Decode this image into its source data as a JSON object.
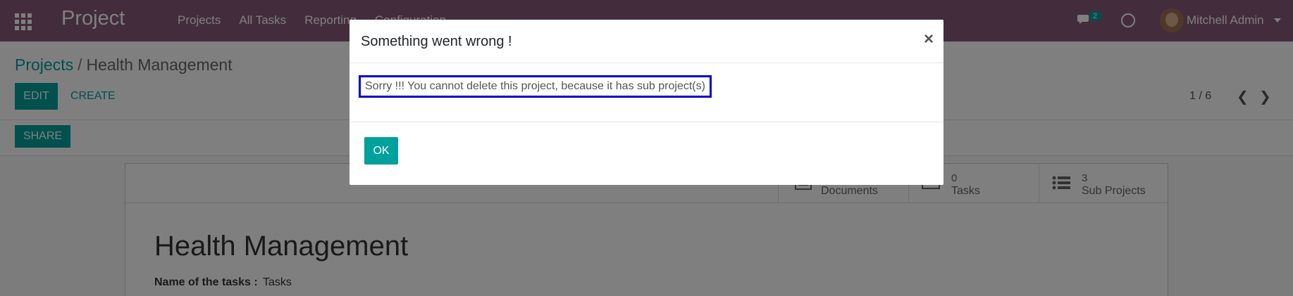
{
  "navbar": {
    "brand": "Project",
    "menu": [
      "Projects",
      "All Tasks",
      "Reporting",
      "Configuration"
    ],
    "chat_count": "2",
    "user_name": "Mitchell Admin",
    "color": "#875a7b"
  },
  "breadcrumb": {
    "parent": "Projects",
    "separator": "/",
    "current": "Health Management"
  },
  "actions": {
    "edit": "EDIT",
    "create": "CREATE",
    "share": "SHARE",
    "pager": "1 / 6"
  },
  "stats": [
    {
      "value": "",
      "label": "Documents",
      "icon": "document-icon"
    },
    {
      "value": "0",
      "label": "Tasks",
      "icon": "tasks-icon"
    },
    {
      "value": "3",
      "label": "Sub Projects",
      "icon": "list-icon"
    }
  ],
  "form": {
    "title": "Health Management",
    "tasks_label": "Name of the tasks :",
    "tasks_value": "Tasks"
  },
  "dialog": {
    "title": "Something went wrong !",
    "close": "×",
    "message": "Sorry !!! You cannot delete this project, because it has sub project(s)",
    "ok": "OK"
  },
  "colors": {
    "accent": "#00a09d",
    "highlight": "#0000cc"
  }
}
